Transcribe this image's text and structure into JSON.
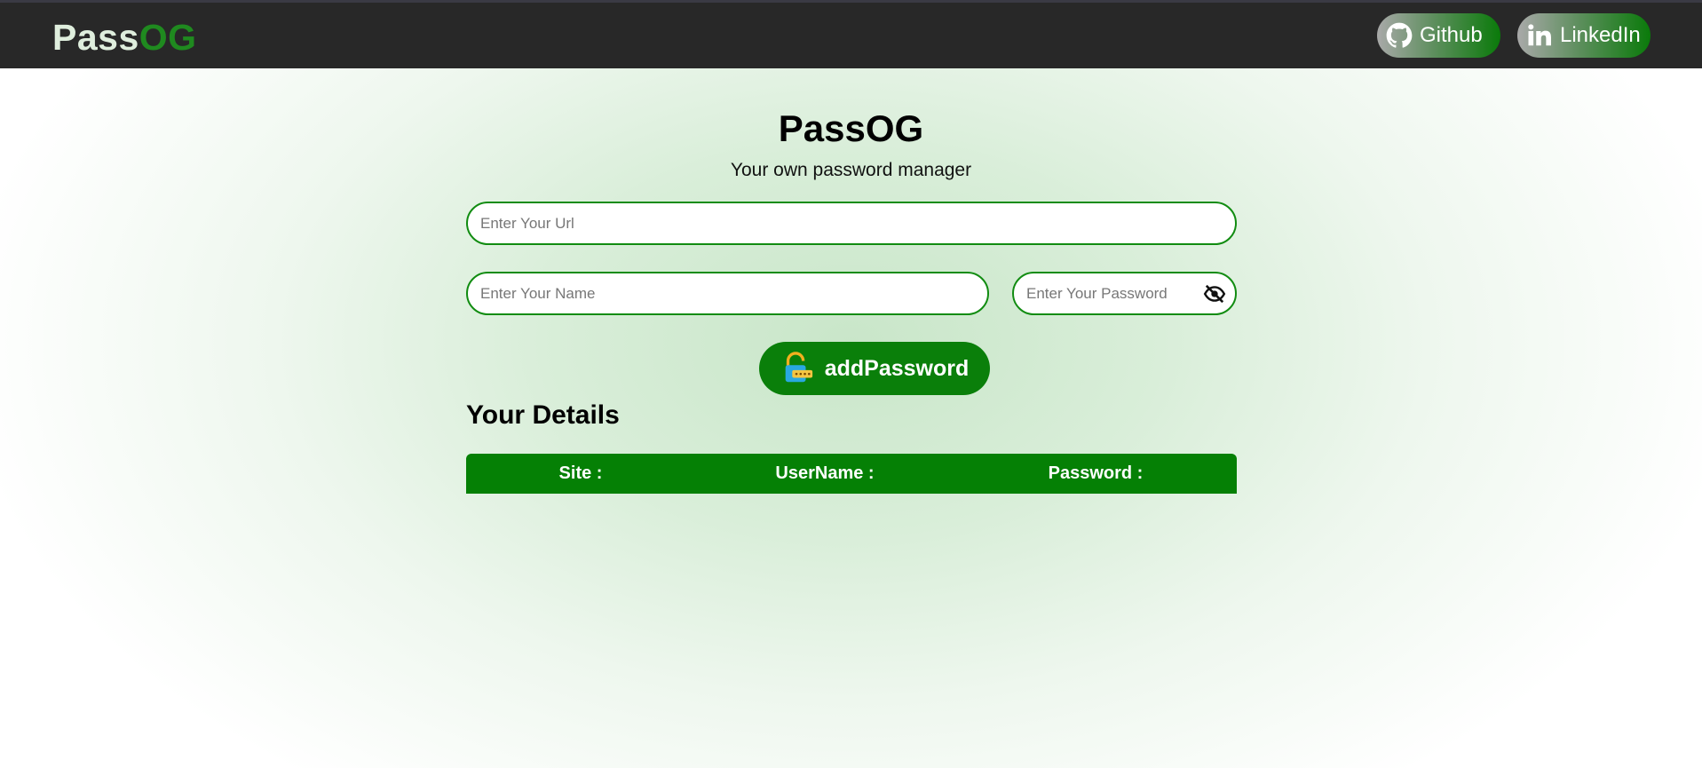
{
  "navbar": {
    "brand_part1": "Pass",
    "brand_part2": "OG",
    "github_label": "Github",
    "linkedin_label": "LinkedIn"
  },
  "header": {
    "title": "PassOG",
    "subtitle": "Your own password manager"
  },
  "form": {
    "url_placeholder": "Enter Your Url",
    "name_placeholder": "Enter Your Name",
    "password_placeholder": "Enter Your Password",
    "add_button_label": "addPassword"
  },
  "details": {
    "heading": "Your Details",
    "columns": [
      "Site :",
      "UserName :",
      "Password :"
    ]
  },
  "icons": {
    "github": "github-icon",
    "linkedin": "linkedin-icon",
    "eye_toggle": "eye-slash-icon",
    "add_lock": "lock-icon"
  },
  "colors": {
    "navbar_bg": "#282828",
    "brand_light": "#dfeedd",
    "brand_green": "#1f8a1f",
    "accent_green": "#0a7f0a",
    "input_border": "#118c11"
  }
}
